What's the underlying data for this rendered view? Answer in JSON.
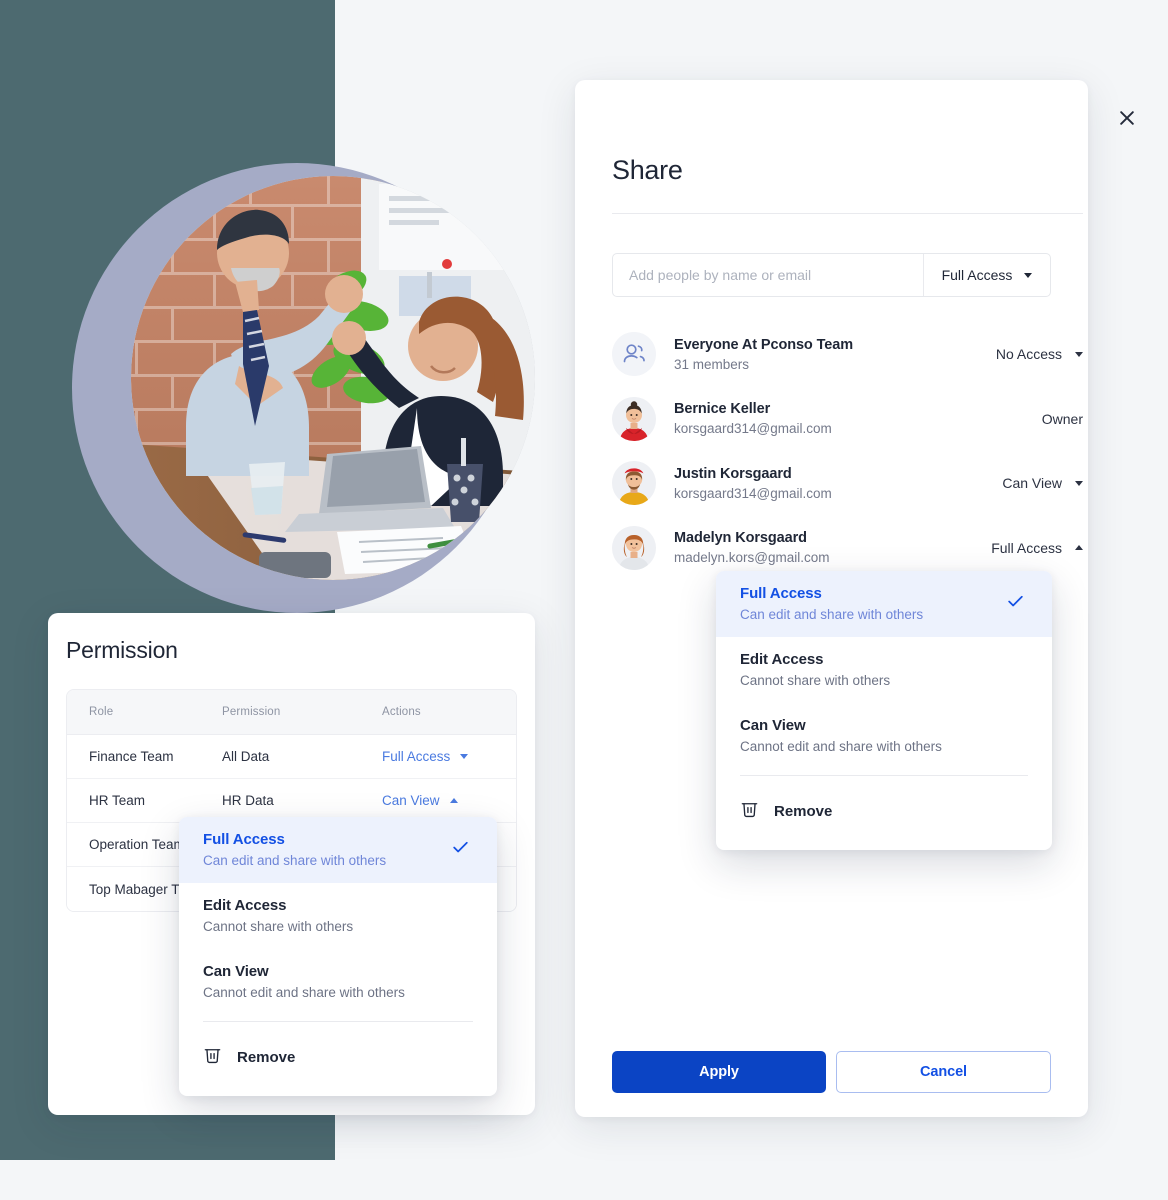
{
  "theme": {
    "left_panel_bg": "#4d6a70",
    "right_panel_bg": "#f4f6f8",
    "accent_blue": "#1350e4",
    "accent_blue_dark": "#0b44c4",
    "link_blue": "#4a7ae0",
    "selected_row_bg": "#edf2fd",
    "ring_lavender": "#a5abc6"
  },
  "hero": {
    "photo_alt": "Two business colleagues high-fiving at a desk with a laptop",
    "decor_name": "lavender-ring"
  },
  "permission_panel": {
    "title": "Permission",
    "columns": [
      "Role",
      "Permission",
      "Actions"
    ],
    "rows": [
      {
        "role": "Finance Team",
        "permission": "All Data",
        "action": "Full Access",
        "caret": "down"
      },
      {
        "role": "HR Team",
        "permission": "HR Data",
        "action": "Can View",
        "caret": "up"
      },
      {
        "role": "Operation Team",
        "permission": "",
        "action": "",
        "caret": ""
      },
      {
        "role": "Top Mabager  T",
        "permission": "",
        "action": "",
        "caret": ""
      }
    ]
  },
  "access_menu": {
    "options": [
      {
        "title": "Full Access",
        "subtitle": "Can edit and share with others",
        "selected": true
      },
      {
        "title": "Edit Access",
        "subtitle": "Cannot share with others",
        "selected": false
      },
      {
        "title": "Can View",
        "subtitle": "Cannot edit and share with others",
        "selected": false
      }
    ],
    "remove_label": "Remove",
    "remove_icon": "trash-icon",
    "check_icon": "check-icon"
  },
  "share_modal": {
    "title": "Share",
    "close_icon": "close-icon",
    "add_people": {
      "placeholder": "Add people by name or email",
      "value": "",
      "access_label": "Full Access"
    },
    "people": [
      {
        "avatar": "group-icon",
        "name": "Everyone At Pconso Team",
        "sub": "31 members",
        "access": "No Access",
        "caret": "down"
      },
      {
        "avatar": "photo-woman-red",
        "name": "Bernice Keller",
        "sub": "korsgaard314@gmail.com",
        "access": "Owner",
        "caret": ""
      },
      {
        "avatar": "photo-man-yellow",
        "name": "Justin Korsgaard",
        "sub": "korsgaard314@gmail.com",
        "access": "Can View",
        "caret": "down"
      },
      {
        "avatar": "photo-woman-white",
        "name": "Madelyn Korsgaard",
        "sub": "madelyn.kors@gmail.com",
        "access": "Full Access",
        "caret": "up"
      }
    ],
    "footer": {
      "apply_label": "Apply",
      "cancel_label": "Cancel"
    }
  }
}
